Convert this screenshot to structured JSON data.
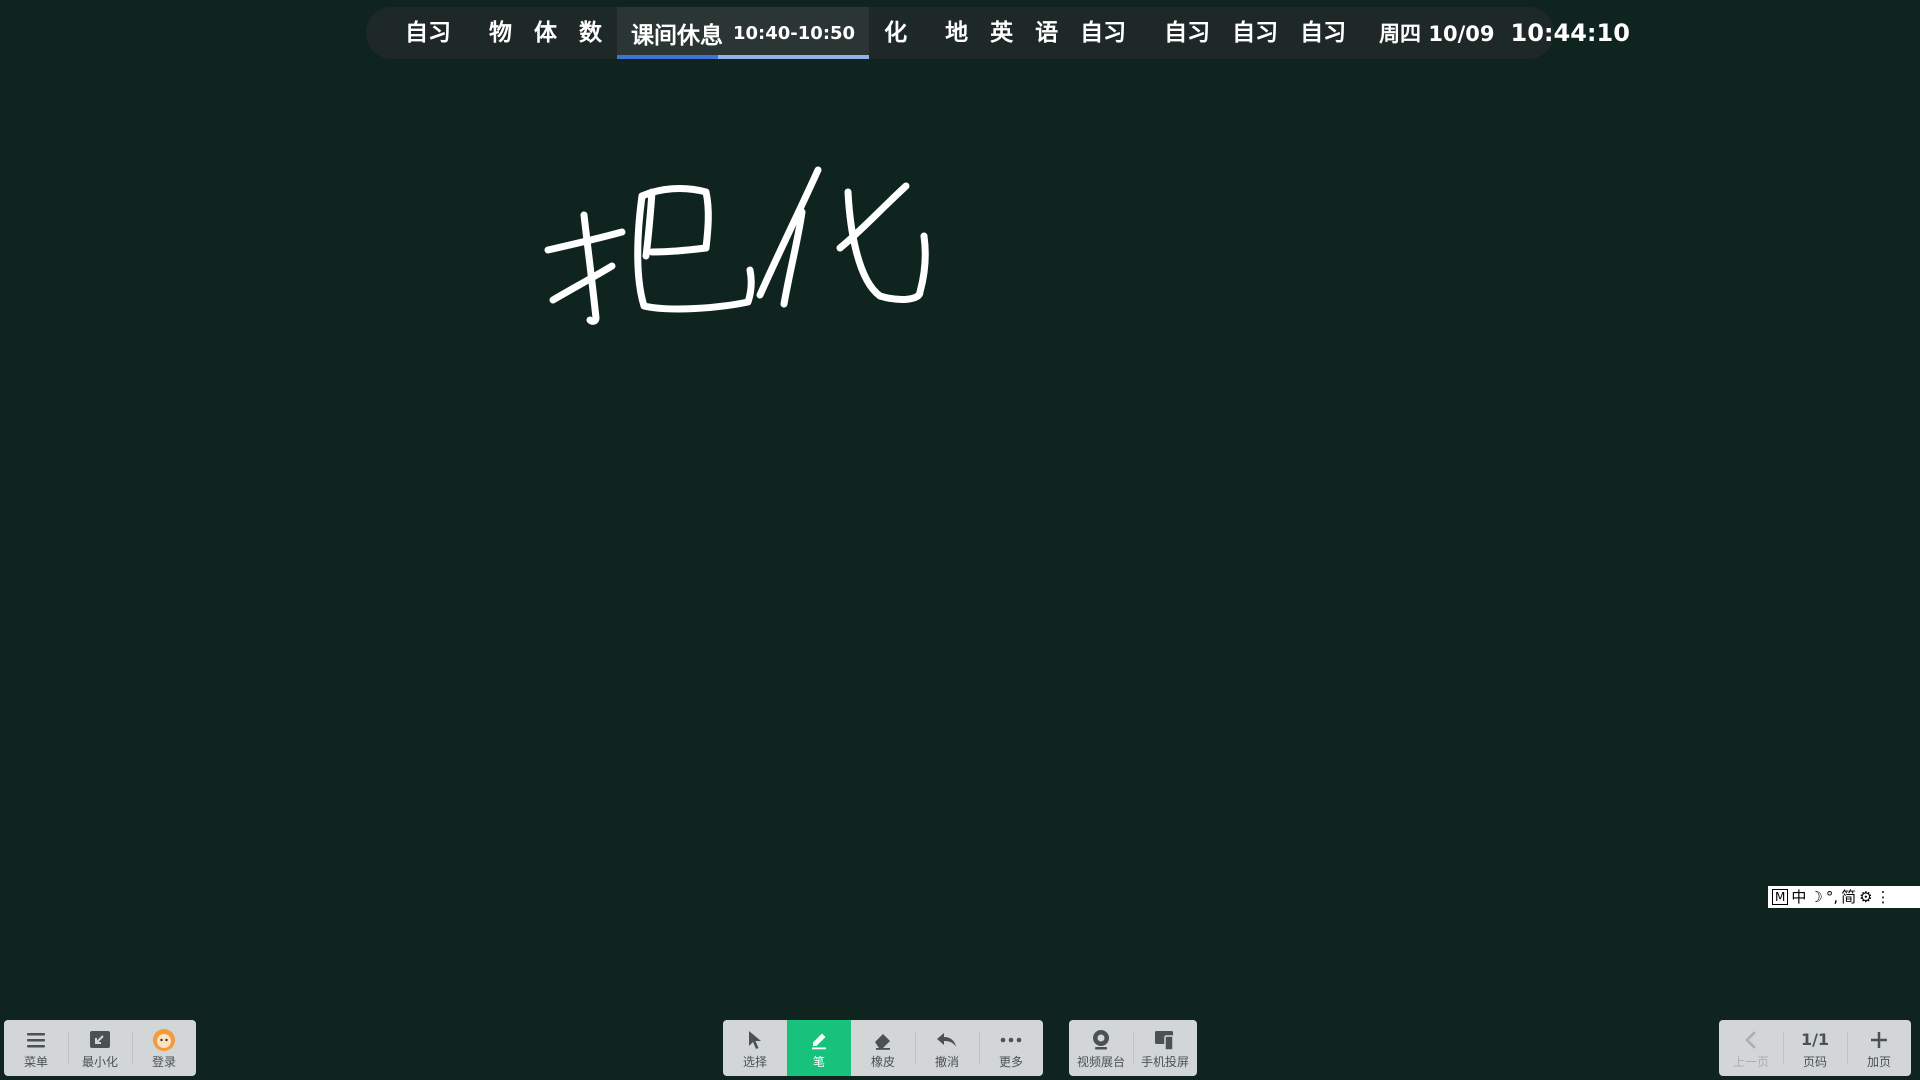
{
  "schedule": {
    "slots_left": [
      "自习"
    ],
    "slots_group2_before": [
      "物",
      "体",
      "数"
    ],
    "current": {
      "label": "课间休息",
      "time_range": "10:40-10:50",
      "progress": 0.4
    },
    "slots_group2_after": [
      "化"
    ],
    "slots_group3": [
      "地",
      "英",
      "语",
      "自习"
    ],
    "slots_group4": [
      "自习",
      "自习",
      "自习"
    ],
    "date": "周四 10/09",
    "time": "10:44:10"
  },
  "ink": {
    "color": "#ffffff"
  },
  "ime": {
    "mode_icon": "M",
    "lang": "中",
    "moon": "☽",
    "punct": "°,",
    "charset": "简",
    "settings": "⚙",
    "more": "⋮"
  },
  "left_toolbar": {
    "menu_label": "菜单",
    "minimize_label": "最小化",
    "login_label": "登录"
  },
  "center_toolbar": {
    "select_label": "选择",
    "pen_label": "笔",
    "eraser_label": "橡皮",
    "undo_label": "撤消",
    "more_label": "更多",
    "accent": "#17c27c"
  },
  "share_toolbar": {
    "video_booth_label": "视频展台",
    "phone_cast_label": "手机投屏"
  },
  "page_toolbar": {
    "prev_label": "上一页",
    "page_indicator": "1/1",
    "page_label": "页码",
    "add_label": "加页"
  }
}
